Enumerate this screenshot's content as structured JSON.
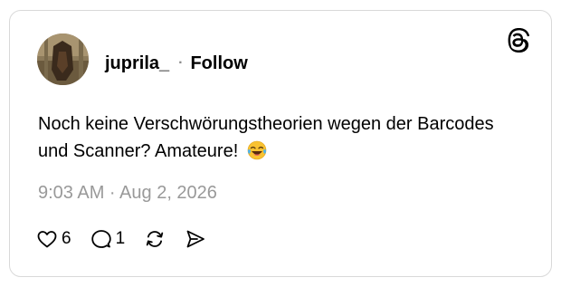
{
  "post": {
    "username": "juprila_",
    "separator": "·",
    "follow_label": "Follow",
    "text": "Noch keine Verschwörungstheorien wegen der Barcodes und Scanner? Amateure!",
    "emoji": "face-with-tears-of-joy",
    "timestamp": "9:03 AM · Aug 2, 2026",
    "likes": "6",
    "replies": "1"
  },
  "icons": {
    "brand": "threads-logo",
    "like": "heart-icon",
    "reply": "comment-icon",
    "repost": "repost-icon",
    "share": "send-icon"
  },
  "colors": {
    "text": "#000000",
    "muted": "#999999",
    "border": "#d9d9d9"
  }
}
